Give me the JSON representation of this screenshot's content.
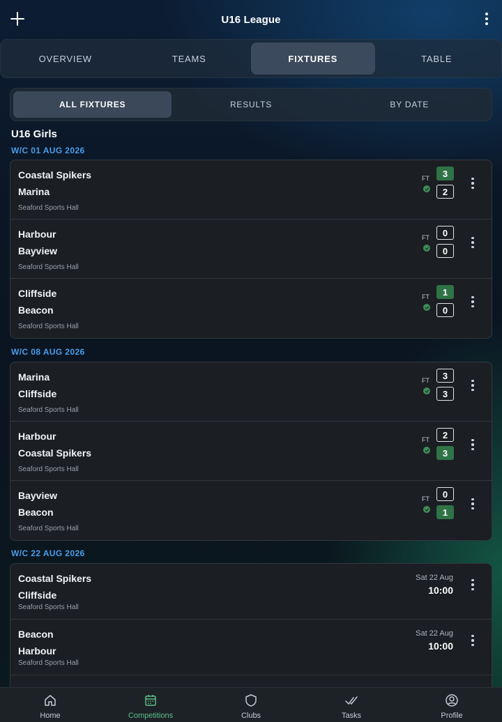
{
  "header": {
    "title": "U16 League"
  },
  "tabs": [
    "OVERVIEW",
    "TEAMS",
    "FIXTURES",
    "TABLE"
  ],
  "active_tab": "FIXTURES",
  "subtabs": [
    "ALL FIXTURES",
    "RESULTS",
    "BY DATE"
  ],
  "active_subtab": "ALL FIXTURES",
  "group": "U16 Girls",
  "weeks": [
    {
      "label": "W/C 01 AUG 2026",
      "fixtures": [
        {
          "home": "Coastal Spikers",
          "away": "Marina",
          "venue": "Seaford Sports Hall",
          "status": "FT",
          "home_score": "3",
          "away_score": "2"
        },
        {
          "home": "Harbour",
          "away": "Bayview",
          "venue": "Seaford Sports Hall",
          "status": "FT",
          "home_score": "0",
          "away_score": "0"
        },
        {
          "home": "Cliffside",
          "away": "Beacon",
          "venue": "Seaford Sports Hall",
          "status": "FT",
          "home_score": "1",
          "away_score": "0"
        }
      ]
    },
    {
      "label": "W/C 08 AUG 2026",
      "fixtures": [
        {
          "home": "Marina",
          "away": "Cliffside",
          "venue": "Seaford Sports Hall",
          "status": "FT",
          "home_score": "3",
          "away_score": "3"
        },
        {
          "home": "Harbour",
          "away": "Coastal Spikers",
          "venue": "Seaford Sports Hall",
          "status": "FT",
          "home_score": "2",
          "away_score": "3"
        },
        {
          "home": "Bayview",
          "away": "Beacon",
          "venue": "Seaford Sports Hall",
          "status": "FT",
          "home_score": "0",
          "away_score": "1"
        }
      ]
    },
    {
      "label": "W/C 22 AUG 2026",
      "fixtures": [
        {
          "home": "Coastal Spikers",
          "away": "Cliffside",
          "venue": "Seaford Sports Hall",
          "date": "Sat 22 Aug",
          "time": "10:00"
        },
        {
          "home": "Beacon",
          "away": "Harbour",
          "venue": "Seaford Sports Hall",
          "date": "Sat 22 Aug",
          "time": "10:00"
        }
      ]
    }
  ],
  "bottom_nav": [
    {
      "label": "Home",
      "icon": "home-icon"
    },
    {
      "label": "Competitions",
      "icon": "calendar-icon"
    },
    {
      "label": "Clubs",
      "icon": "shield-icon"
    },
    {
      "label": "Tasks",
      "icon": "double-check-icon"
    },
    {
      "label": "Profile",
      "icon": "profile-icon"
    }
  ],
  "active_nav": "Competitions",
  "colors": {
    "accent_blue": "#4a9dec",
    "win_green": "#2f7346",
    "nav_active": "#5cc08a",
    "card_bg": "#1b1e22"
  }
}
